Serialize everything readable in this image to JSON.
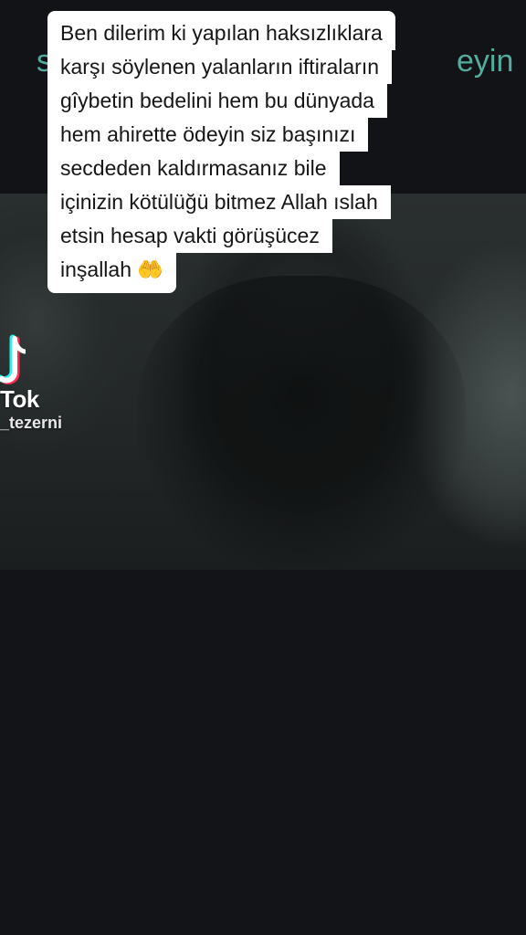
{
  "background": {
    "frame_color": "#121316",
    "ghost_text_color": "#5fc7b5"
  },
  "ghost_title": {
    "left_fragment": "s",
    "right_fragment": "eyin"
  },
  "caption": {
    "lines": [
      "Ben dilerim ki yapılan haksızlıklara",
      "karşı söylenen yalanların iftiraların",
      "gîybetin bedelini hem bu dünyada",
      "hem ahirette ödeyin siz başınızı",
      "secdeden kaldırmasanız bile",
      "içinizin kötülüğü bitmez Allah ıslah",
      "etsin hesap vakti görüşücez",
      "inşallah"
    ],
    "emoji": "🤲"
  },
  "watermark": {
    "brand": "Tok",
    "username": "_tezerni",
    "icon": "tiktok-logo-icon",
    "colors": {
      "cyan": "#25f4ee",
      "red": "#fe2c55",
      "white": "#ffffff"
    }
  }
}
